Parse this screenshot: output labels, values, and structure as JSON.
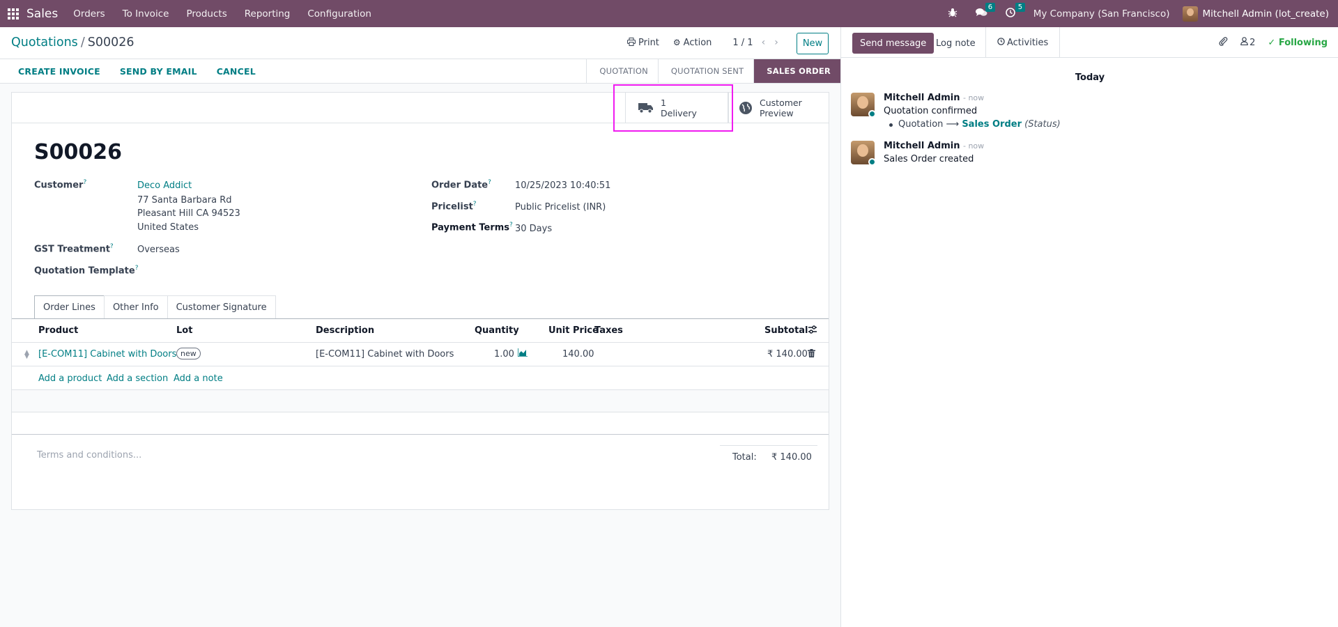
{
  "navbar": {
    "brand": "Sales",
    "menu": [
      "Orders",
      "To Invoice",
      "Products",
      "Reporting",
      "Configuration"
    ],
    "messages_count": "6",
    "activities_count": "5",
    "company": "My Company (San Francisco)",
    "user": "Mitchell Admin (lot_create)"
  },
  "control_panel": {
    "breadcrumb_parent": "Quotations",
    "breadcrumb_sep": "/",
    "breadcrumb_current": "S00026",
    "print_label": "Print",
    "action_label": "Action",
    "pager": "1 / 1",
    "new_label": "New"
  },
  "statusbar": {
    "buttons": [
      "CREATE INVOICE",
      "SEND BY EMAIL",
      "CANCEL"
    ],
    "stages": [
      "QUOTATION",
      "QUOTATION SENT",
      "SALES ORDER"
    ],
    "active_stage": "SALES ORDER"
  },
  "smart_buttons": {
    "delivery_count": "1",
    "delivery_label": "Delivery",
    "preview_line1": "Customer",
    "preview_line2": "Preview"
  },
  "form": {
    "name": "S00026",
    "customer_label": "Customer",
    "customer_name": "Deco Addict",
    "address_line1": "77 Santa Barbara Rd",
    "address_line2": "Pleasant Hill CA 94523",
    "address_line3": "United States",
    "gst_label": "GST Treatment",
    "gst_value": "Overseas",
    "template_label": "Quotation Template",
    "order_date_label": "Order Date",
    "order_date_value": "10/25/2023 10:40:51",
    "pricelist_label": "Pricelist",
    "pricelist_value": "Public Pricelist (INR)",
    "payment_terms_label": "Payment Terms",
    "payment_terms_value": "30 Days",
    "help_mark": "?"
  },
  "tabs": [
    "Order Lines",
    "Other Info",
    "Customer Signature"
  ],
  "order_lines": {
    "columns": {
      "product": "Product",
      "lot": "Lot",
      "description": "Description",
      "quantity": "Quantity",
      "unit_price": "Unit Price",
      "taxes": "Taxes",
      "subtotal": "Subtotal"
    },
    "rows": [
      {
        "product": "[E-COM11] Cabinet with Doors",
        "lot": "new",
        "description": "[E-COM11] Cabinet with Doors",
        "quantity": "1.00",
        "unit_price": "140.00",
        "taxes": "",
        "subtotal": "₹ 140.00"
      }
    ],
    "add_product": "Add a product",
    "add_section": "Add a section",
    "add_note": "Add a note"
  },
  "footer": {
    "terms_placeholder": "Terms and conditions...",
    "total_label": "Total:",
    "total_value": "₹ 140.00"
  },
  "chatter": {
    "send_message": "Send message",
    "log_note": "Log note",
    "activities": "Activities",
    "followers_count": "2",
    "following": "Following",
    "date_separator": "Today",
    "messages": [
      {
        "author": "Mitchell Admin",
        "time": "- now",
        "body": "Quotation confirmed",
        "tracking_old": "Quotation",
        "tracking_new": "Sales Order",
        "tracking_field": "(Status)"
      },
      {
        "author": "Mitchell Admin",
        "time": "- now",
        "body": "Sales Order created"
      }
    ]
  },
  "colors": {
    "brand": "#714b67",
    "accent": "#017e84",
    "following": "#28a745",
    "highlight": "#f01bf0"
  }
}
